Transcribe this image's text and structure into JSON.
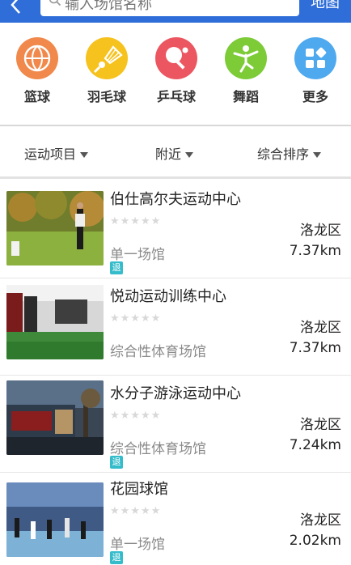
{
  "header": {
    "search_placeholder": "输入场馆名称",
    "map_label": "地图"
  },
  "categories": [
    {
      "label": "篮球",
      "icon": "basketball-icon",
      "color": "#f0894b"
    },
    {
      "label": "羽毛球",
      "icon": "badminton-icon",
      "color": "#f6c21e"
    },
    {
      "label": "乒乓球",
      "icon": "table-tennis-icon",
      "color": "#ec5660"
    },
    {
      "label": "舞蹈",
      "icon": "dance-icon",
      "color": "#7ccb37"
    },
    {
      "label": "更多",
      "icon": "more-icon",
      "color": "#4fa9ee"
    }
  ],
  "filters": [
    {
      "label": "运动项目"
    },
    {
      "label": "附近"
    },
    {
      "label": "综合排序"
    }
  ],
  "venues": [
    {
      "name": "伯仕高尔夫运动中心",
      "rating_stars": "★★★★★",
      "district": "洛龙区",
      "type": "单一场馆",
      "distance": "7.37km",
      "refund_badge": "退"
    },
    {
      "name": "悦动运动训练中心",
      "rating_stars": "★★★★★",
      "district": "洛龙区",
      "type": "综合性体育场馆",
      "distance": "7.37km"
    },
    {
      "name": "水分子游泳运动中心",
      "rating_stars": "★★★★★",
      "district": "洛龙区",
      "type": "综合性体育场馆",
      "distance": "7.24km",
      "refund_badge": "退"
    },
    {
      "name": "花园球馆",
      "rating_stars": "★★★★★",
      "district": "洛龙区",
      "type": "单一场馆",
      "distance": "2.02km",
      "refund_badge": "退"
    }
  ],
  "colors": {
    "header_bg": "#2f6ed8",
    "refund_badge": "#35bccb"
  }
}
